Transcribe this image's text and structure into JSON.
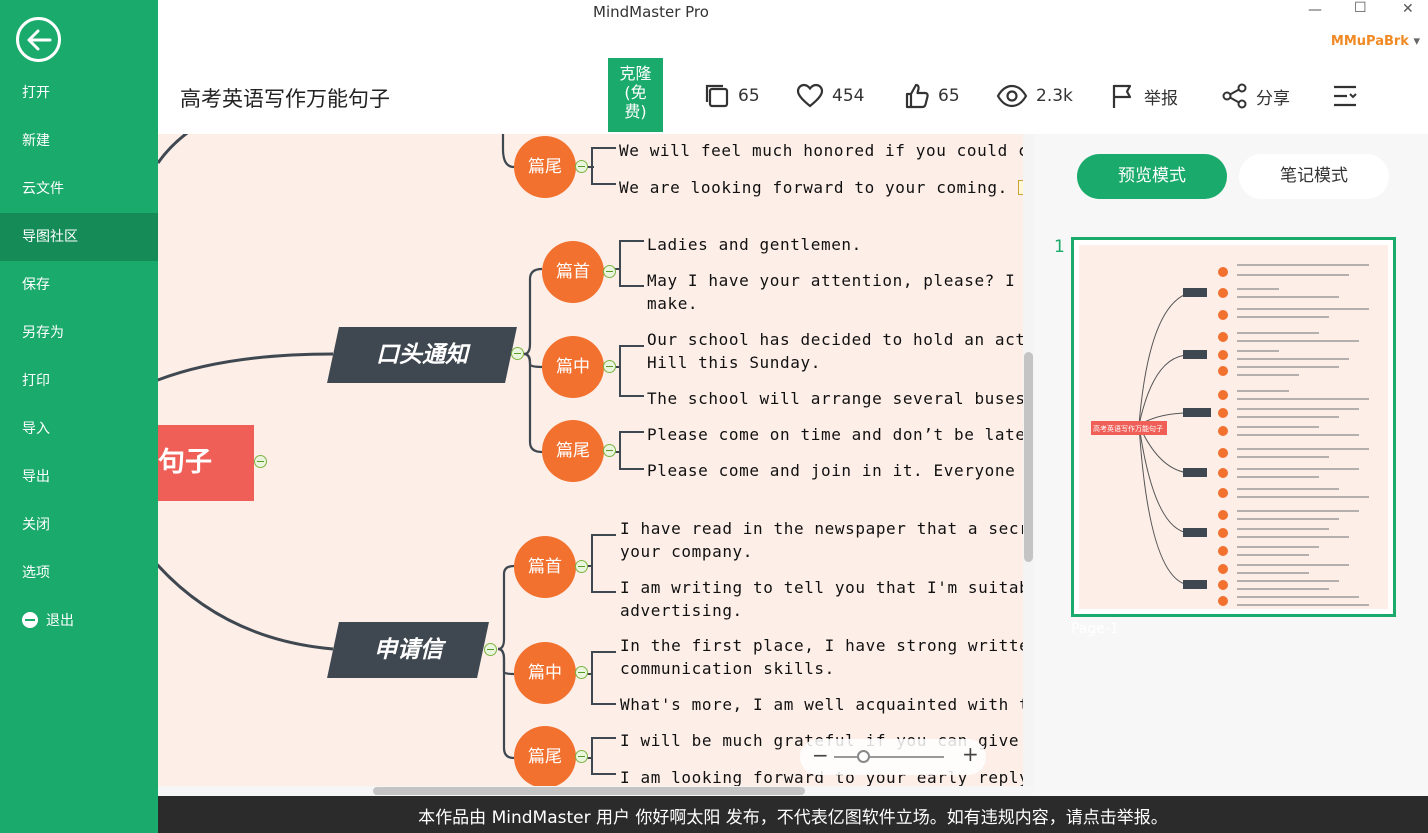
{
  "app": {
    "title": "MindMaster Pro",
    "user": "MMuPaBrk",
    "user_caret": "▾"
  },
  "window": {
    "minimize": "—",
    "maximize": "☐",
    "close": "✕"
  },
  "sidebar": {
    "items": [
      {
        "label": "打开"
      },
      {
        "label": "新建"
      },
      {
        "label": "云文件"
      },
      {
        "label": "导图社区"
      },
      {
        "label": "保存"
      },
      {
        "label": "另存为"
      },
      {
        "label": "打印"
      },
      {
        "label": "导入"
      },
      {
        "label": "导出"
      },
      {
        "label": "关闭"
      },
      {
        "label": "选项"
      },
      {
        "label": "退出"
      }
    ]
  },
  "toolbar": {
    "doc_title": "高考英语写作万能句子",
    "clone_line1": "克隆",
    "clone_line2": "(免",
    "clone_line3": "费)",
    "copies": "65",
    "likes": "454",
    "thumbs": "65",
    "views": "2.3k",
    "report": "举报",
    "share": "分享"
  },
  "mindmap": {
    "root_label": "句子",
    "topics": [
      {
        "label": "口头通知"
      },
      {
        "label": "申请信"
      }
    ],
    "branches": {
      "b0": "篇尾",
      "b1": "篇首",
      "b2": "篇中",
      "b3": "篇尾",
      "b4": "篇首",
      "b5": "篇中",
      "b6": "篇尾"
    },
    "texts": {
      "t0": "We will feel much honored if you could co",
      "t1": "We are looking forward to your coming.",
      "t2": "Ladies and gentlemen.",
      "t3a": "May I have your attention, please? I h",
      "t3b": "make.",
      "t4a": "Our school has decided to hold an acti",
      "t4b": "Hill this Sunday.",
      "t5": "The school will arrange several buses",
      "t6": "Please come on time and don’t be late",
      "t7": "Please come and join in it. Everyone i",
      "t8a": " I have read in the newspaper that a secr",
      "t8b": "your company.",
      "t9a": "I am writing to tell you that I'm suitab",
      "t9b": "advertising.",
      "t10a": "In the first place, I have strong writter",
      "t10b": "communication skills.",
      "t11": "What's more, I am well acquainted with th",
      "t12": "I will be much grateful if you can give m",
      "t13": "I am looking forward to your early reply."
    },
    "zoom_minus": "−",
    "zoom_plus": "+"
  },
  "right_panel": {
    "preview_mode": "预览模式",
    "note_mode": "笔记模式",
    "page_number": "1",
    "page_label": "Page-1",
    "thumb_root": "高考英语写作万能句子"
  },
  "footer": {
    "text": "本作品由 MindMaster 用户 你好啊太阳 发布，不代表亿图软件立场。如有违规内容，请点击举报。"
  }
}
